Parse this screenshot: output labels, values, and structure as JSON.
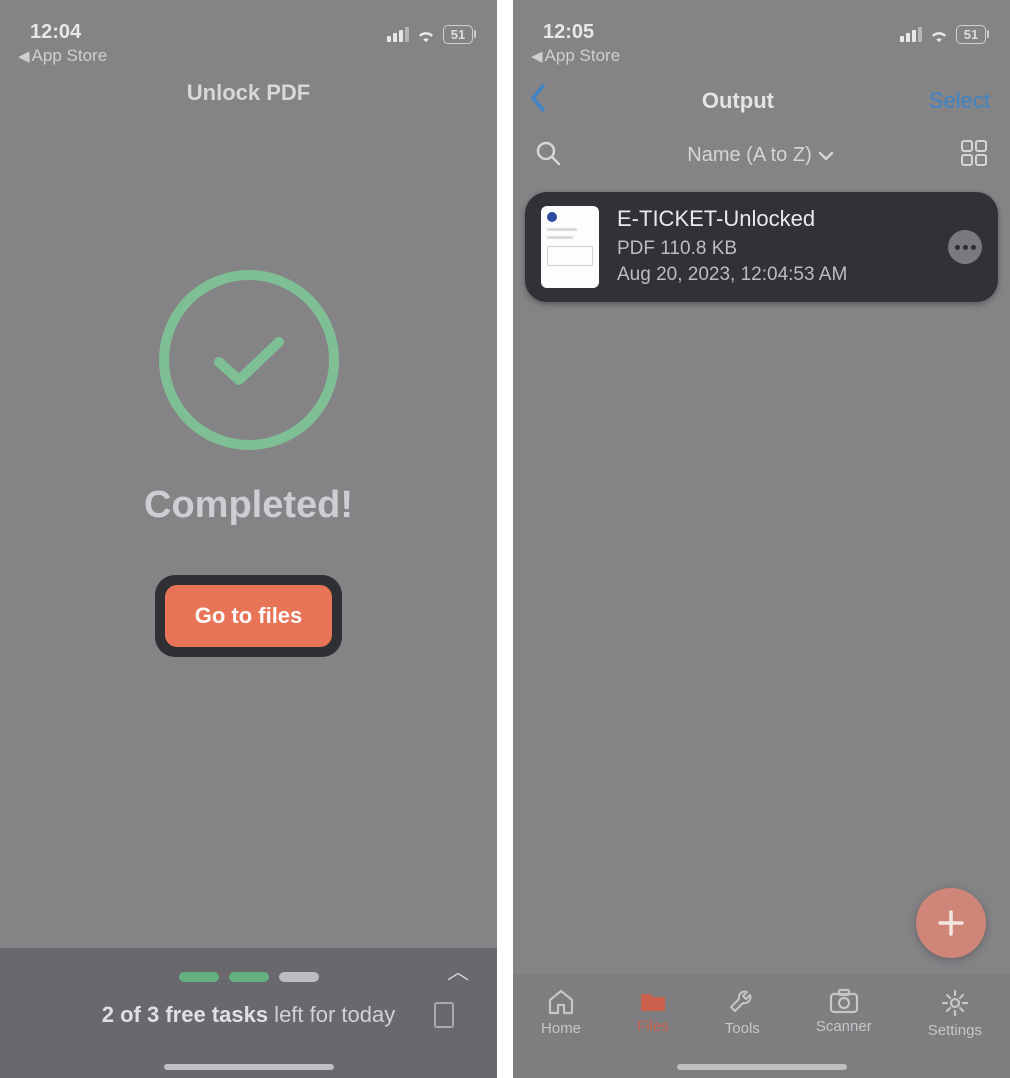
{
  "left": {
    "status": {
      "time": "12:04",
      "battery": "51"
    },
    "back_app": "App Store",
    "title": "Unlock PDF",
    "completed": "Completed!",
    "go_to_files": "Go to files",
    "tasks_bold": "2 of 3 free tasks",
    "tasks_rest": " left for today"
  },
  "right": {
    "status": {
      "time": "12:05",
      "battery": "51"
    },
    "back_app": "App Store",
    "nav": {
      "title": "Output",
      "select": "Select"
    },
    "sort_label": "Name (A to Z)",
    "file": {
      "name": "E-TICKET-Unlocked",
      "type_size": "PDF 110.8 KB",
      "date": "Aug 20, 2023, 12:04:53 AM"
    },
    "tabs": {
      "home": "Home",
      "files": "Files",
      "tools": "Tools",
      "scanner": "Scanner",
      "settings": "Settings"
    }
  }
}
